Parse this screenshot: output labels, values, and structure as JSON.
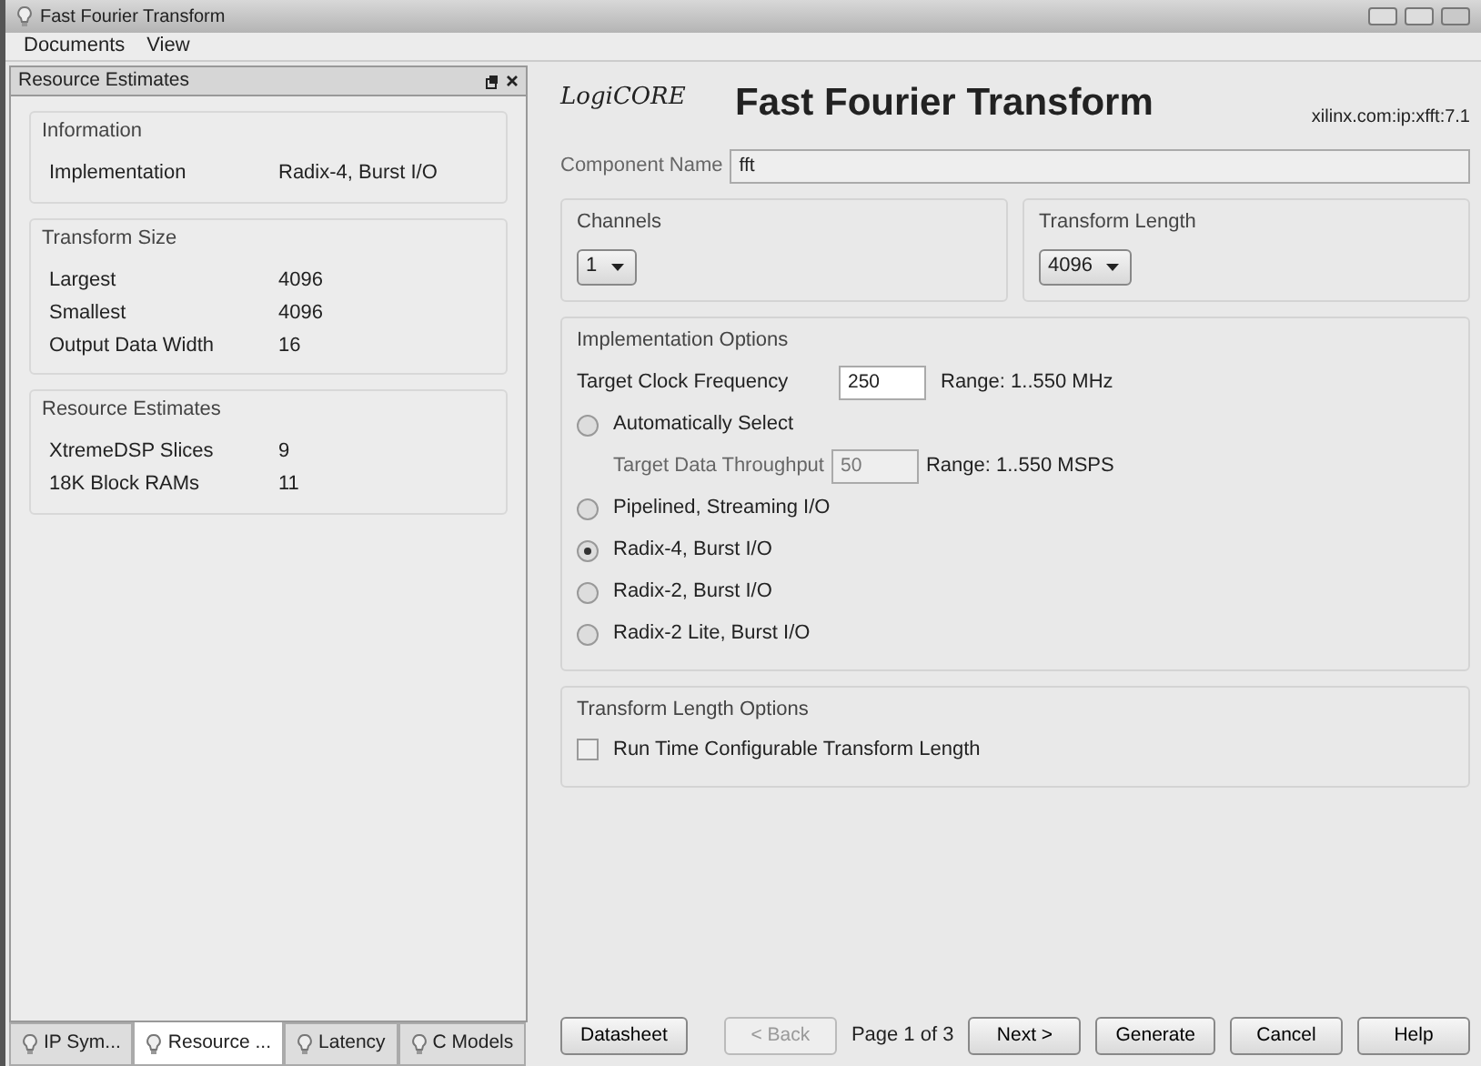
{
  "window": {
    "title": "Fast Fourier Transform"
  },
  "menu": [
    {
      "label": "Documents"
    },
    {
      "label": "View"
    }
  ],
  "left_panel": {
    "title": "Resource Estimates",
    "groups": [
      {
        "title": "Information",
        "rows": [
          {
            "label": "Implementation",
            "value": "Radix-4, Burst I/O"
          }
        ]
      },
      {
        "title": "Transform Size",
        "rows": [
          {
            "label": "Largest",
            "value": "4096"
          },
          {
            "label": "Smallest",
            "value": "4096"
          },
          {
            "label": "Output Data Width",
            "value": "16"
          }
        ]
      },
      {
        "title": "Resource Estimates",
        "rows": [
          {
            "label": "XtremeDSP Slices",
            "value": "9"
          },
          {
            "label": "18K Block RAMs",
            "value": "11"
          }
        ]
      }
    ],
    "tabs": [
      {
        "label": "IP Sym...",
        "selected": false
      },
      {
        "label": "Resource ...",
        "selected": true
      },
      {
        "label": "Latency",
        "selected": false
      },
      {
        "label": "C Models",
        "selected": false
      }
    ]
  },
  "header": {
    "logo": "LogiCORE",
    "title": "Fast Fourier Transform",
    "id": "xilinx.com:ip:xfft:7.1"
  },
  "component_name": {
    "label": "Component Name",
    "value": "fft"
  },
  "channels": {
    "title": "Channels",
    "value": "1"
  },
  "transform_length": {
    "title": "Transform Length",
    "value": "4096"
  },
  "implementation": {
    "title": "Implementation Options",
    "clock_label": "Target Clock Frequency",
    "clock_value": "250",
    "clock_range": "Range: 1..550  MHz",
    "options": [
      {
        "label": "Automatically Select",
        "selected": false,
        "throughput": {
          "label": "Target Data Throughput",
          "value": "50",
          "disabled": true,
          "range": "Range: 1..550  MSPS"
        }
      },
      {
        "label": "Pipelined, Streaming I/O",
        "selected": false
      },
      {
        "label": "Radix-4, Burst I/O",
        "selected": true
      },
      {
        "label": "Radix-2, Burst I/O",
        "selected": false
      },
      {
        "label": "Radix-2 Lite, Burst I/O",
        "selected": false
      }
    ]
  },
  "length_options": {
    "title": "Transform Length Options",
    "checkbox": {
      "label": "Run Time Configurable Transform Length",
      "checked": false
    }
  },
  "footer": {
    "datasheet": {
      "label": "Datasheet"
    },
    "page": "Page 1 of 3",
    "buttons": [
      {
        "label": "< Back",
        "disabled": true
      },
      {
        "label": "Next >",
        "disabled": false
      },
      {
        "label": "Generate",
        "disabled": false
      },
      {
        "label": "Cancel",
        "disabled": false
      },
      {
        "label": "Help",
        "disabled": false
      }
    ]
  }
}
